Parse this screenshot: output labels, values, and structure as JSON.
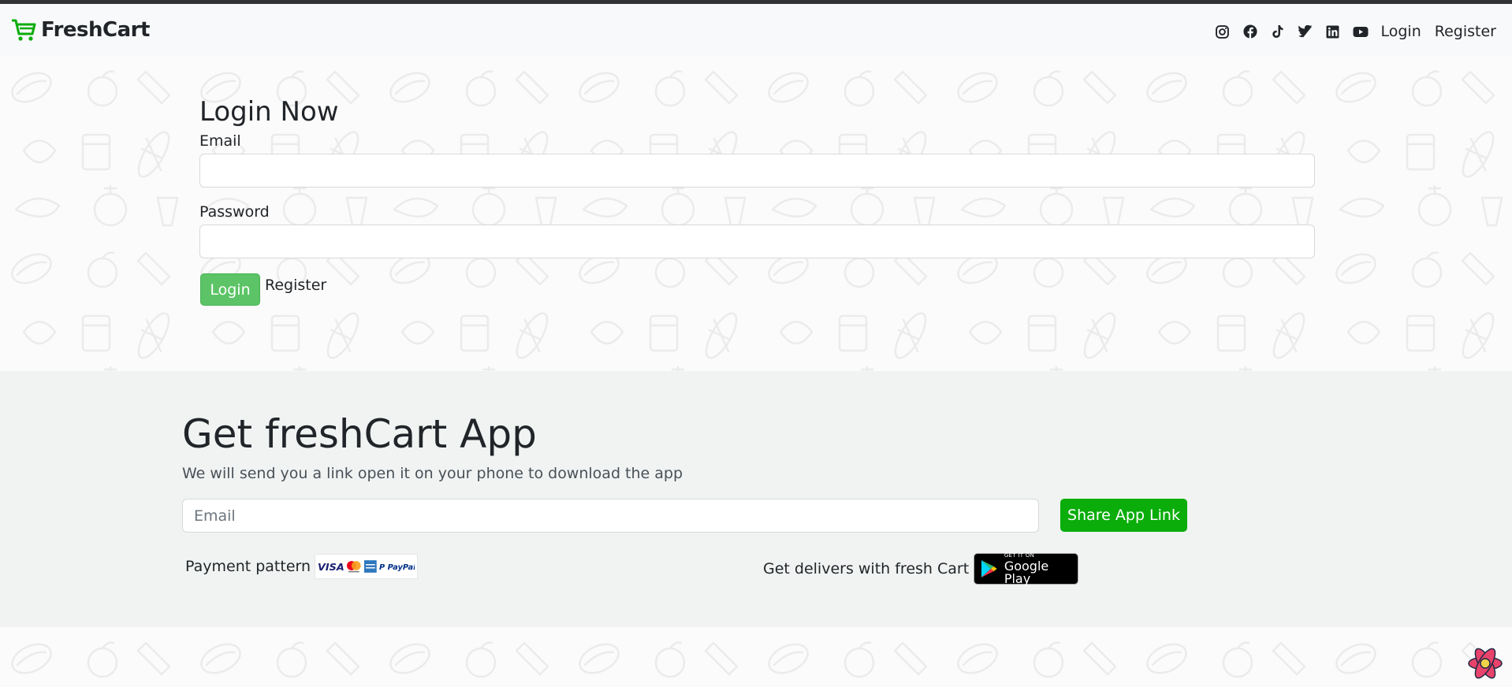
{
  "navbar": {
    "brand": "FreshCart",
    "social": [
      {
        "icon": "instagram-icon"
      },
      {
        "icon": "facebook-icon"
      },
      {
        "icon": "tiktok-icon"
      },
      {
        "icon": "twitter-icon"
      },
      {
        "icon": "linkedin-icon"
      },
      {
        "icon": "youtube-icon"
      }
    ],
    "links": {
      "login": "Login",
      "register": "Register"
    }
  },
  "login_form": {
    "title": "Login Now",
    "email_label": "Email",
    "email_value": "",
    "password_label": "Password",
    "password_value": "",
    "submit_label": "Login",
    "register_label": "Register"
  },
  "app_section": {
    "title": "Get freshCart App",
    "subtitle": "We will send you a link open it on your phone to download the app",
    "email_placeholder": "Email",
    "share_button": "Share App Link",
    "payment_label": "Payment pattern",
    "payment_logos": [
      "VISA",
      "Mastercard",
      "AmEx",
      "PayPal"
    ],
    "delivers_label": "Get delivers with fresh Cart",
    "store_badge": {
      "small": "GET IT ON",
      "big": "Google Play"
    }
  },
  "colors": {
    "accent_green": "#0aad0a",
    "login_green": "#5cc466",
    "footer_bg": "#f0f3f2",
    "navbar_bg": "#f8f9fa"
  }
}
